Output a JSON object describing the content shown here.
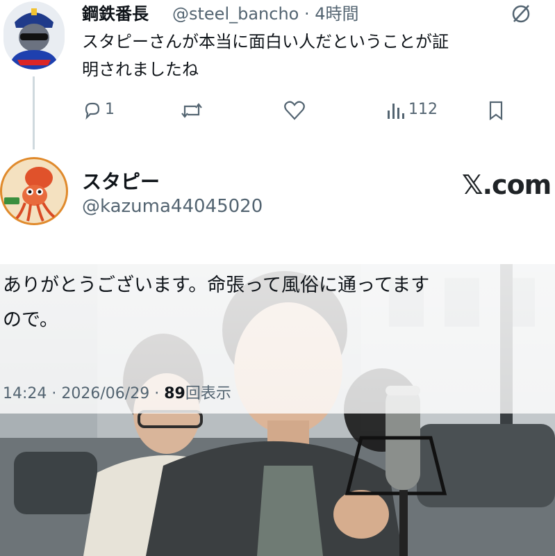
{
  "reply": {
    "display_name": "鋼鉄番長",
    "handle": "@steel_bancho",
    "sep": "·",
    "time": "4時間",
    "text_line1": "スタピーさんが本当に面白い人だということが証",
    "text_line2": "明されましたね",
    "reply_count": "1",
    "view_count": "112",
    "icons": [
      "reply-icon",
      "retweet-icon",
      "like-icon",
      "views-icon",
      "bookmark-icon",
      "grok-icon"
    ]
  },
  "main_post": {
    "display_name": "スタピー",
    "handle": "@kazuma44045020",
    "text_line1": "ありがとうございます。命張って風俗に通ってます",
    "text_line2": "ので。",
    "time": "14:24",
    "sep1": "·",
    "date": "2026/06/29",
    "sep2": "·",
    "view_count": "89",
    "view_label": "回表示"
  },
  "watermark": "𝕏.com",
  "colors": {
    "text": "#0f1419",
    "secondary": "#536471",
    "line": "#cfd9de"
  }
}
